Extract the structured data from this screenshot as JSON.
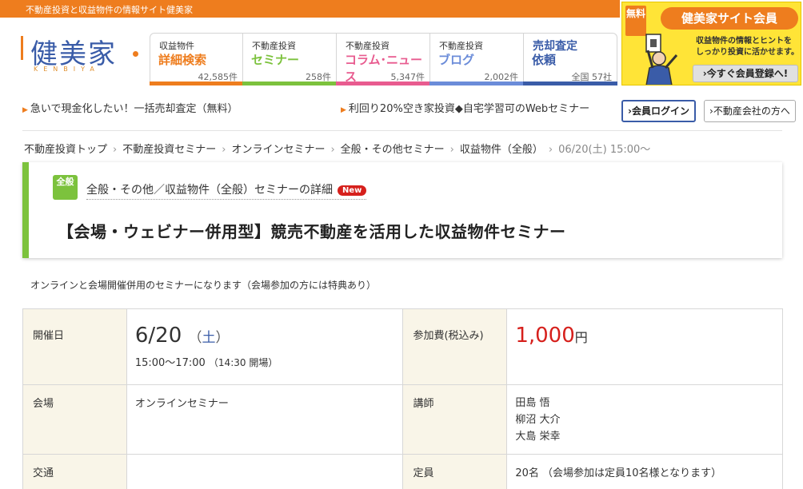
{
  "topbar": {
    "text": "不動産投資と収益物件の情報サイト健美家"
  },
  "logo": {
    "main": "健美家",
    "sub": "KENBIYA"
  },
  "nav": [
    {
      "kicker": "収益物件",
      "title": "詳細検索",
      "count": "42,585件",
      "color": "#ee7d1e"
    },
    {
      "kicker": "不動産投資",
      "title": "セミナー",
      "count": "258件",
      "color": "#7cc23d"
    },
    {
      "kicker": "不動産投資",
      "title": "コラム･ニュース",
      "count": "5,347件",
      "color": "#e85b8f"
    },
    {
      "kicker": "不動産投資",
      "title": "ブログ",
      "count": "2,002件",
      "color": "#6b8cd9"
    },
    {
      "kicker": "売却査定",
      "title": "依頼",
      "count": "全国 57社",
      "color": "#3a5ca8"
    }
  ],
  "banner": {
    "free": "無料",
    "title": "健美家サイト会員",
    "desc_line1": "収益物件の情報とヒントを",
    "desc_line2": "しっかり投資に活かせます。",
    "cta": "›今すぐ会員登録へ!"
  },
  "sublinks": {
    "left": "急いで現金化したい！一括売却査定（無料）",
    "right": "利回り20%空き家投資◆自宅学習可のWebセミナー",
    "login": "会員ログイン",
    "agents": "不動産会社の方へ"
  },
  "breadcrumb": {
    "items": [
      "不動産投資トップ",
      "不動産投資セミナー",
      "オンラインセミナー",
      "全般・その他セミナー",
      "収益物件（全般）"
    ],
    "current": "06/20(土) 15:00～"
  },
  "seminar": {
    "category_badge": "全般",
    "subheading": "全般・その他／収益物件（全般）セミナーの詳細",
    "new_badge": "New",
    "title": "【会場・ウェビナー併用型】競売不動産を活用した収益物件セミナー",
    "note": "オンラインと会場開催併用のセミナーになります（会場参加の方には特典あり）"
  },
  "details": {
    "date_label": "開催日",
    "date": "6/20",
    "weekday_open": "（",
    "weekday": "土",
    "weekday_close": "）",
    "time": "15:00～17:00",
    "doors": "（14:30 開場）",
    "fee_label": "参加費(税込み)",
    "fee": "1,000",
    "fee_unit": "円",
    "venue_label": "会場",
    "venue": "オンラインセミナー",
    "speaker_label": "講師",
    "speakers": [
      "田島 悟",
      "柳沼 大介",
      "大島 栄幸"
    ],
    "access_label": "交通",
    "access": "",
    "capacity_label": "定員",
    "capacity": "20名 （会場参加は定員10名様となります）"
  }
}
